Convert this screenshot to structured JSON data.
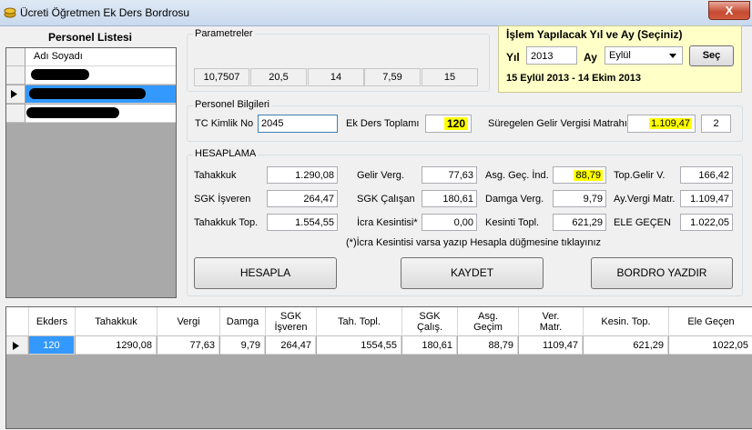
{
  "window": {
    "title": "Ücreti Öğretmen Ek Ders Bordrosu",
    "close_label": "X"
  },
  "personel": {
    "title": "Personel Listesi",
    "column": "Adı Soyadı"
  },
  "parametreler": {
    "title": "Parametreler",
    "values": [
      "10,7507",
      "20,5",
      "14",
      "7,59",
      "15"
    ]
  },
  "yil_ay": {
    "title": "İşlem Yapılacak Yıl ve Ay (Seçiniz)",
    "yil_label": "Yıl",
    "yil_value": "2013",
    "ay_label": "Ay",
    "ay_value": "Eylül",
    "sec_button": "Seç",
    "date_range": "15 Eylül 2013 - 14 Ekim 2013"
  },
  "personel_bilgileri": {
    "title": "Personel Bilgileri",
    "tc_label": "TC Kimlik No",
    "tc_value": "2045",
    "ek_ders_label": "Ek Ders Toplamı",
    "ek_ders_value": "120",
    "gelir_matrah_label": "Süregelen Gelir Vergisi Matrahı",
    "gelir_matrah_value": "1.109,47",
    "extra_value": "2"
  },
  "hesaplama": {
    "title": "HESAPLAMA",
    "tahakkuk_label": "Tahakkuk",
    "tahakkuk_value": "1.290,08",
    "sgk_isveren_label": "SGK İşveren",
    "sgk_isveren_value": "264,47",
    "tahakkuk_top_label": "Tahakkuk Top.",
    "tahakkuk_top_value": "1.554,55",
    "gelir_verg_label": "Gelir Verg.",
    "gelir_verg_value": "77,63",
    "sgk_calisan_label": "SGK Çalışan",
    "sgk_calisan_value": "180,61",
    "icra_label": "İcra Kesintisi*",
    "icra_value": "0,00",
    "asg_gec_label": "Asg. Geç. İnd.",
    "asg_gec_value": "88,79",
    "damga_label": "Damga Verg.",
    "damga_value": "9,79",
    "kesinti_label": "Kesinti Topl.",
    "kesinti_value": "621,29",
    "top_gelir_label": "Top.Gelir V.",
    "top_gelir_value": "166,42",
    "ay_vergi_label": "Ay.Vergi Matr.",
    "ay_vergi_value": "1.109,47",
    "ele_gecen_label": "ELE GEÇEN",
    "ele_gecen_value": "1.022,05",
    "note": "(*)İcra Kesintisi varsa yazıp Hesapla düğmesine tıklayınız",
    "hesapla_button": "HESAPLA",
    "kaydet_button": "KAYDET",
    "bordro_button": "BORDRO YAZDIR"
  },
  "grid": {
    "headers": [
      "Ekders",
      "Tahakkuk",
      "Vergi",
      "Damga",
      "SGK\nİşveren",
      "Tah. Topl.",
      "SGK\nÇalış.",
      "Asg.\nGeçim",
      "Ver.\nMatr.",
      "Kesin. Top.",
      "Ele Geçen"
    ],
    "rows": [
      [
        "120",
        "1290,08",
        "77,63",
        "9,79",
        "264,47",
        "1554,55",
        "180,61",
        "88,79",
        "1109,47",
        "621,29",
        "1022,05"
      ]
    ]
  },
  "colors": {
    "highlight": "#ffff00",
    "selection": "#3399ff",
    "year_panel": "#ffffc8"
  }
}
